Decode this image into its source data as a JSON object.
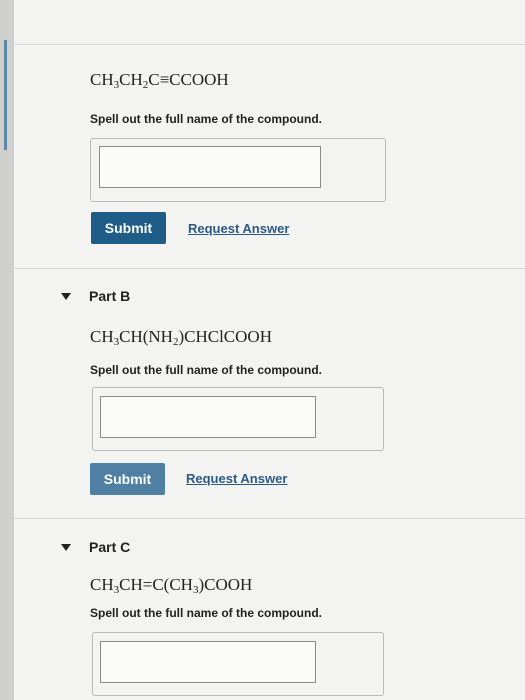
{
  "colors": {
    "submit_primary": "#1f5d88",
    "submit_faded": "#4f7fa2",
    "link": "#2c5a86"
  },
  "partA": {
    "formula": [
      "CH",
      "3",
      "CH",
      "2",
      "C≡CCOOH"
    ],
    "instruction": "Spell out the full name of the compound.",
    "input_value": "",
    "submit_label": "Submit",
    "request_answer_label": "Request Answer"
  },
  "partB": {
    "title": "Part B",
    "formula": [
      "CH",
      "3",
      "CH(NH",
      "2",
      ")CHClCOOH"
    ],
    "instruction": "Spell out the full name of the compound.",
    "input_value": "",
    "submit_label": "Submit",
    "request_answer_label": "Request Answer"
  },
  "partC": {
    "title": "Part C",
    "formula": [
      "CH",
      "3",
      "CH=C(CH",
      "3",
      ")COOH"
    ],
    "instruction": "Spell out the full name of the compound.",
    "input_value": ""
  }
}
